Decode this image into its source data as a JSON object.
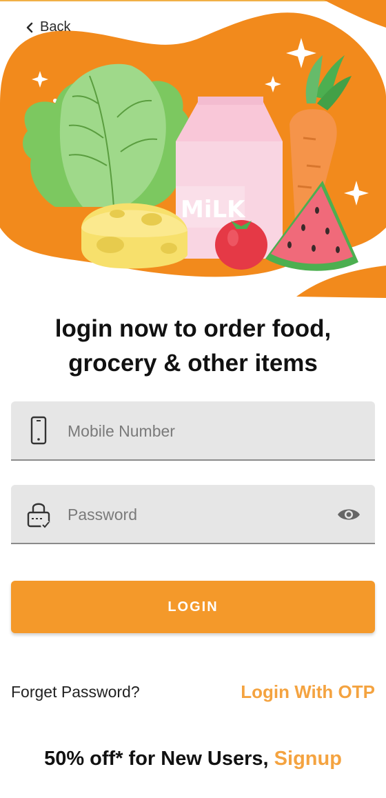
{
  "header": {
    "back_label": "Back"
  },
  "hero": {
    "carton_text": "MiLK"
  },
  "headline": {
    "line1": "login now to order food,",
    "line2": "grocery & other items"
  },
  "form": {
    "mobile_placeholder": "Mobile Number",
    "mobile_value": "",
    "password_placeholder": "Password",
    "password_value": ""
  },
  "actions": {
    "login_label": "LOGIN",
    "forget_label": "Forget Password?",
    "otp_label": "Login With OTP"
  },
  "promo": {
    "text": "50% off* for New Users, ",
    "link": "Signup"
  },
  "colors": {
    "accent": "#f4992a",
    "link": "#f4a340",
    "field_bg": "#e6e6e6",
    "hero_blob": "#f28a1c"
  },
  "icons": [
    "back-arrow-icon",
    "phone-icon",
    "lock-icon",
    "eye-icon"
  ]
}
